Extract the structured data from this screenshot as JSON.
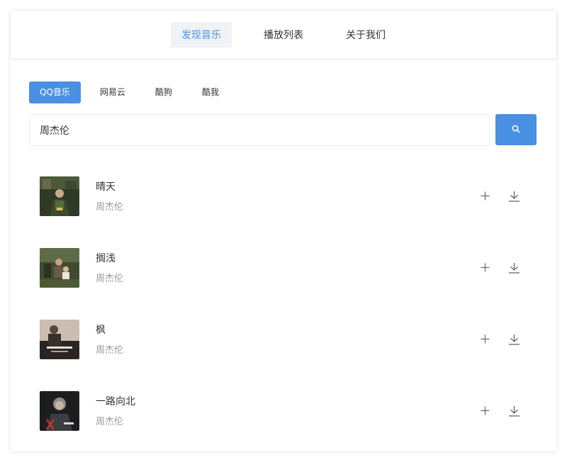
{
  "nav": {
    "items": [
      {
        "label": "发现音乐",
        "active": true
      },
      {
        "label": "播放列表",
        "active": false
      },
      {
        "label": "关于我们",
        "active": false
      }
    ]
  },
  "sources": [
    {
      "label": "QQ音乐",
      "active": true
    },
    {
      "label": "网易云",
      "active": false
    },
    {
      "label": "酷狗",
      "active": false
    },
    {
      "label": "酷我",
      "active": false
    }
  ],
  "search": {
    "value": "周杰伦",
    "button_icon": "search-icon"
  },
  "songs": [
    {
      "title": "晴天",
      "artist": "周杰伦"
    },
    {
      "title": "搁浅",
      "artist": "周杰伦"
    },
    {
      "title": "枫",
      "artist": "周杰伦"
    },
    {
      "title": "一路向北",
      "artist": "周杰伦"
    }
  ],
  "icons": {
    "add": "plus-icon",
    "download": "download-icon"
  },
  "colors": {
    "accent": "#4a90e2",
    "muted": "#999999",
    "nav_active_bg": "#f0f2f5"
  }
}
